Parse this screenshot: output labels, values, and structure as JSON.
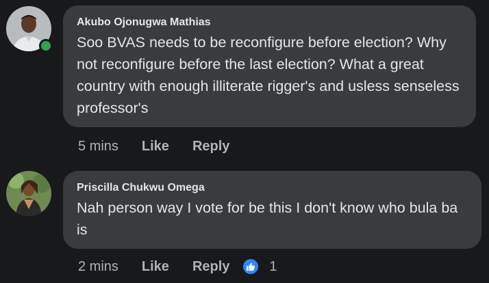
{
  "comments": [
    {
      "author": "Akubo Ojonugwa Mathias",
      "text": "Soo BVAS needs to be reconfigure before election? Why not reconfigure before the last election? What a great country with enough illiterate rigger's and usless senseless professor's",
      "time": "5 mins",
      "like_label": "Like",
      "reply_label": "Reply",
      "online": true,
      "avatar_icon": "user-photo-icon"
    },
    {
      "author": "Priscilla Chukwu Omega",
      "text": "Nah person way I vote for be this I don't know who bula ba is",
      "time": "2 mins",
      "like_label": "Like",
      "reply_label": "Reply",
      "reaction_icon": "thumbs-up-icon",
      "reaction_count": "1",
      "avatar_icon": "user-photo-icon"
    }
  ],
  "colors": {
    "background": "#18191a",
    "bubble": "#3a3b3c",
    "text": "#e4e6eb",
    "muted": "#b0b3b8",
    "online": "#31a24c",
    "like_blue": "#2d88ff"
  }
}
